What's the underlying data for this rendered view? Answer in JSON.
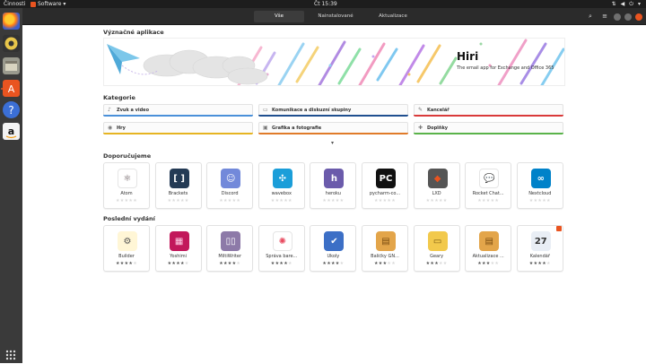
{
  "topbar": {
    "activities": "Činnosti",
    "app_menu": "Software ▾",
    "clock": "Čt 15:39",
    "sys_icons": [
      "network-icon",
      "volume-icon",
      "power-icon"
    ]
  },
  "header": {
    "tabs": [
      {
        "label": "Vše",
        "active": true
      },
      {
        "label": "Nainstalované",
        "active": false
      },
      {
        "label": "Aktualizace",
        "active": false
      }
    ]
  },
  "dock": {
    "items": [
      "firefox-icon",
      "rhythmbox-icon",
      "files-icon",
      "software-icon",
      "help-icon",
      "amazon-icon"
    ],
    "show_apps": "show-apps-icon"
  },
  "featured": {
    "title": "Význačné aplikace",
    "banner_app": "Hiri",
    "banner_tagline": "The email app for Exchange and Office 365"
  },
  "categories": {
    "title": "Kategorie",
    "items": [
      {
        "label": "Zvuk a video",
        "color": "#4a90d9",
        "icon": "♪"
      },
      {
        "label": "Komunikace a diskuzní skupiny",
        "color": "#1f4f8f",
        "icon": "▭"
      },
      {
        "label": "Kancelář",
        "color": "#d93a3a",
        "icon": "✎"
      },
      {
        "label": "Hry",
        "color": "#e6b422",
        "icon": "◉"
      },
      {
        "label": "Grafika a fotografie",
        "color": "#e07b2a",
        "icon": "▣"
      },
      {
        "label": "Doplňky",
        "color": "#5ab34a",
        "icon": "✚"
      }
    ],
    "expand": "▾"
  },
  "recommended": {
    "title": "Doporučujeme",
    "apps": [
      {
        "name": "Atom",
        "icon": "atom-icon",
        "glyph": "⚛",
        "bg": "#ffffff",
        "fg": "#66595c",
        "stars": 0
      },
      {
        "name": "Brackets",
        "icon": "brackets-icon",
        "glyph": "[ ]",
        "bg": "#243b55",
        "fg": "#ffffff",
        "stars": 0
      },
      {
        "name": "Discord",
        "icon": "discord-icon",
        "glyph": "☺",
        "bg": "#7289da",
        "fg": "#ffffff",
        "stars": 0
      },
      {
        "name": "wavebox",
        "icon": "wavebox-icon",
        "glyph": "✣",
        "bg": "#1b9ed9",
        "fg": "#ffffff",
        "stars": 0
      },
      {
        "name": "heroku",
        "icon": "heroku-icon",
        "glyph": "h",
        "bg": "#6b5bab",
        "fg": "#ffffff",
        "stars": 0
      },
      {
        "name": "pycharm-co...",
        "icon": "pycharm-icon",
        "glyph": "PC",
        "bg": "#111111",
        "fg": "#ffffff",
        "stars": 0
      },
      {
        "name": "LXD",
        "icon": "lxd-icon",
        "glyph": "◆",
        "bg": "#555555",
        "fg": "#e95420",
        "stars": 0
      },
      {
        "name": "Rocket Chat...",
        "icon": "rocketchat-icon",
        "glyph": "💬",
        "bg": "#ffffff",
        "fg": "#cc2222",
        "stars": 0
      },
      {
        "name": "Nextcloud",
        "icon": "nextcloud-icon",
        "glyph": "∞",
        "bg": "#0082c9",
        "fg": "#ffffff",
        "stars": 0
      }
    ]
  },
  "recent": {
    "title": "Poslední vydání",
    "apps": [
      {
        "name": "Builder",
        "icon": "builder-icon",
        "glyph": "⚙",
        "bg": "#fff6d6",
        "fg": "#555",
        "stars": 4
      },
      {
        "name": "Yoshimi",
        "icon": "yoshimi-icon",
        "glyph": "▦",
        "bg": "#c2185b",
        "fg": "#ffd1e8",
        "stars": 4
      },
      {
        "name": "MiltiWriter",
        "icon": "multiwriter-icon",
        "glyph": "▯▯",
        "bg": "#8d7aa8",
        "fg": "#ffffff",
        "stars": 4
      },
      {
        "name": "Správa bare...",
        "icon": "color-icon",
        "glyph": "✺",
        "bg": "#ffffff",
        "fg": "#e84a5f",
        "stars": 4
      },
      {
        "name": "Úkoly",
        "icon": "tasks-icon",
        "glyph": "✔",
        "bg": "#3c6fc6",
        "fg": "#ffffff",
        "stars": 4
      },
      {
        "name": "Balíčky GN...",
        "icon": "packages-icon",
        "glyph": "▤",
        "bg": "#e3a54a",
        "fg": "#7a4c10",
        "stars": 3
      },
      {
        "name": "Geary",
        "icon": "geary-icon",
        "glyph": "▭",
        "bg": "#f2c94c",
        "fg": "#7a5a12",
        "stars": 3
      },
      {
        "name": "Aktualizace ...",
        "icon": "updates-icon",
        "glyph": "▤",
        "bg": "#e3a54a",
        "fg": "#7a4c10",
        "stars": 3
      },
      {
        "name": "Kalendář",
        "icon": "calendar-icon",
        "glyph": "27",
        "bg": "#e9eef5",
        "fg": "#333333",
        "stars": 4
      }
    ]
  },
  "colors": {
    "accent": "#e95420"
  }
}
